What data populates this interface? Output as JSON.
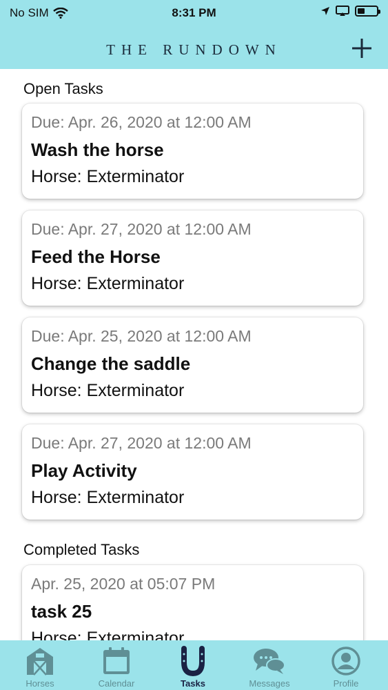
{
  "status_bar": {
    "carrier": "No SIM",
    "time": "8:31 PM"
  },
  "header": {
    "title": "THE RUNDOWN"
  },
  "open_tasks": {
    "heading": "Open Tasks",
    "items": [
      {
        "due": "Due: Apr. 26, 2020 at 12:00 AM",
        "title": "Wash the horse",
        "horse": "Horse: Exterminator"
      },
      {
        "due": "Due: Apr. 27, 2020 at 12:00 AM",
        "title": "Feed the Horse",
        "horse": "Horse: Exterminator"
      },
      {
        "due": "Due: Apr. 25, 2020 at 12:00 AM",
        "title": "Change the saddle",
        "horse": "Horse: Exterminator"
      },
      {
        "due": "Due: Apr. 27, 2020 at 12:00 AM",
        "title": "Play Activity",
        "horse": "Horse: Exterminator"
      }
    ]
  },
  "completed_tasks": {
    "heading": "Completed Tasks",
    "items": [
      {
        "date": "Apr. 25, 2020 at 05:07 PM",
        "title": "task 25",
        "horse": "Horse: Exterminator"
      }
    ]
  },
  "tab_bar": {
    "tabs": [
      {
        "label": "Horses",
        "icon": "barn-icon"
      },
      {
        "label": "Calendar",
        "icon": "calendar-icon"
      },
      {
        "label": "Tasks",
        "icon": "horseshoe-icon"
      },
      {
        "label": "Messages",
        "icon": "chat-bubbles-icon"
      },
      {
        "label": "Profile",
        "icon": "profile-icon"
      }
    ],
    "active": "Tasks"
  },
  "colors": {
    "header_bg": "#9be3ea",
    "tab_active": "#1a2244",
    "tab_inactive": "#5f8f95"
  }
}
